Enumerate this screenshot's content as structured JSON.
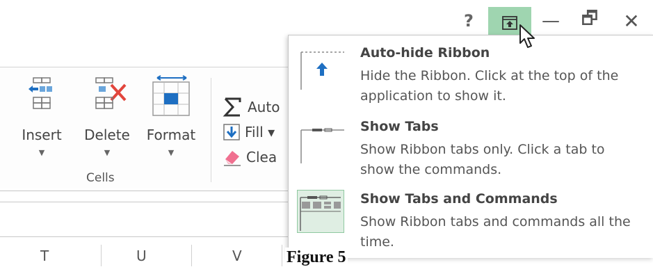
{
  "window_controls": {
    "help": "?",
    "minimize": "—",
    "restore": "🗗",
    "close": "✕"
  },
  "ribbon": {
    "cells_group": {
      "label": "Cells",
      "insert": "Insert",
      "delete": "Delete",
      "format": "Format",
      "dropdown_arrow": "▼"
    },
    "editing": {
      "autosum": "Auto",
      "fill": "Fill ▾",
      "clear": "Clea"
    }
  },
  "sheet": {
    "columns": [
      "T",
      "U",
      "V"
    ]
  },
  "ribbon_display_menu": {
    "options": [
      {
        "title": "Auto-hide Ribbon",
        "description": "Hide the Ribbon. Click at the top of the application to show it."
      },
      {
        "title": "Show Tabs",
        "description": "Show Ribbon tabs only. Click a tab to show the commands."
      },
      {
        "title": "Show Tabs and Commands",
        "description": "Show Ribbon tabs and commands all the time."
      }
    ]
  },
  "caption": "Figure 5",
  "colors": {
    "ribbon_options_highlight": "#9fd5b0",
    "selected_option_bg": "#dfeee3",
    "accent_blue": "#1e6fc2",
    "delete_red": "#e2453c"
  }
}
